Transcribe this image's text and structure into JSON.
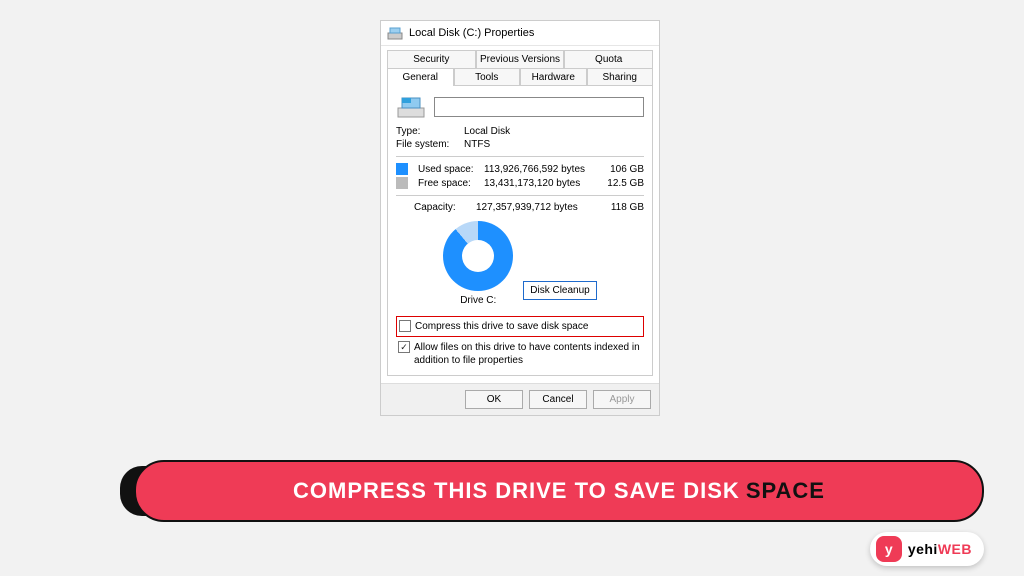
{
  "window": {
    "title": "Local Disk (C:) Properties"
  },
  "tabs": {
    "row1": [
      "Security",
      "Previous Versions",
      "Quota"
    ],
    "row2": [
      "General",
      "Tools",
      "Hardware",
      "Sharing"
    ],
    "active": "General"
  },
  "general": {
    "label_value": "",
    "type_label": "Type:",
    "type_value": "Local Disk",
    "fs_label": "File system:",
    "fs_value": "NTFS",
    "used_label": "Used space:",
    "used_bytes": "113,926,766,592 bytes",
    "used_gb": "106 GB",
    "free_label": "Free space:",
    "free_bytes": "13,431,173,120 bytes",
    "free_gb": "12.5 GB",
    "capacity_label": "Capacity:",
    "capacity_bytes": "127,357,939,712 bytes",
    "capacity_gb": "118 GB",
    "drive_caption": "Drive C:",
    "cleanup_btn": "Disk Cleanup",
    "compress_label": "Compress this drive to save disk space",
    "index_label": "Allow files on this drive to have contents indexed in addition to file properties"
  },
  "buttons": {
    "ok": "OK",
    "cancel": "Cancel",
    "apply": "Apply"
  },
  "banner": {
    "text_main": "COMPRESS THIS DRIVE TO SAVE DISK",
    "text_accent": "SPACE"
  },
  "brand": {
    "part1": "yehi",
    "part2": "WEB",
    "glyph": "y"
  },
  "chart_data": {
    "type": "pie",
    "title": "Drive C:",
    "series": [
      {
        "name": "Used space",
        "value": 113926766592,
        "display": "106 GB",
        "color": "#1e90ff"
      },
      {
        "name": "Free space",
        "value": 13431173120,
        "display": "12.5 GB",
        "color": "#b8d8f8"
      }
    ],
    "total": {
      "name": "Capacity",
      "value": 127357939712,
      "display": "118 GB"
    }
  }
}
